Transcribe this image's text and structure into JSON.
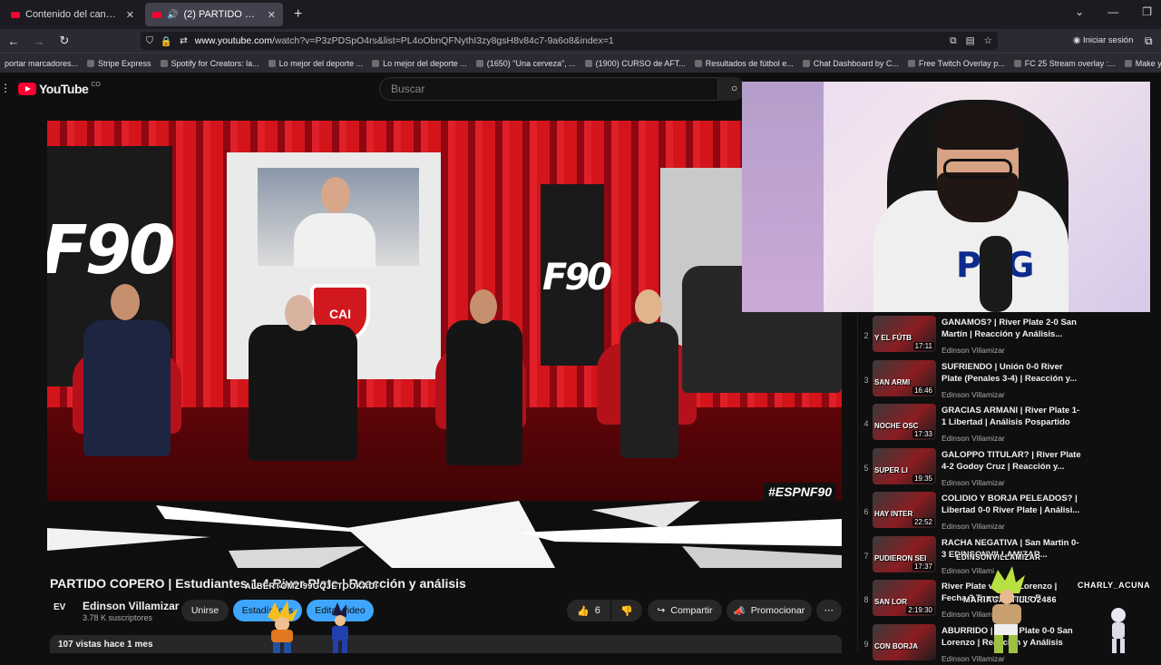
{
  "browser": {
    "tabs": [
      {
        "label": "Contenido del canal - YouTube",
        "active": false
      },
      {
        "label": "(2) PARTIDO COPERO | Estu",
        "active": true
      }
    ],
    "new_tab": "+",
    "window_controls": [
      "⌄",
      "—",
      "❐"
    ],
    "url": {
      "host": "www.youtube.com",
      "path": "/watch?v=P3zPDSpO4rs&list=PL4oObnQFNythI3zy8gsH8v84c7-9a6o8&index=1"
    },
    "sign_in": "Iniciar sesión",
    "bookmarks": [
      "portar marcadores...",
      "Stripe Express",
      "Spotify for Creators: la...",
      "Lo mejor del deporte ...",
      "Lo mejor del deporte ...",
      "(1650) \"Una cerveza\", ...",
      "(1900) CURSO de AFT...",
      "Resultados de fútbol e...",
      "Chat Dashboard by C...",
      "Free Twitch Overlay p...",
      "FC 25 Stream overlay :...",
      "Make your own poster..."
    ]
  },
  "youtube": {
    "logo": "YouTube",
    "logo_country": "CO",
    "search_placeholder": "Buscar"
  },
  "video": {
    "hashtag": "#ESPNF90",
    "f90": "F90",
    "crest": "CAI"
  },
  "title": "PARTIDO COPERO | Estudiantes 1-4 River Plate | Reacción y análisis",
  "overlay": {
    "user1": "ALBERTOMZ 99GQJETOOKADI",
    "user2": "MARIACASTILLO2486",
    "user3": "CHARLY_ACUNA",
    "user4": "EDINSONVILLAMIZAR"
  },
  "channel": {
    "avatar": "EV",
    "name": "Edinson Villamizar",
    "subs": "3.78 K suscriptores",
    "join": "Unirse",
    "stats": "Estadísticas",
    "edit": "Editar video",
    "likes": "6",
    "share": "Compartir",
    "promote": "Promocionar",
    "more": "⋯"
  },
  "description": {
    "views": "107 vistas  hace 1 mes"
  },
  "webcam": {
    "shirt_text": "PSG"
  },
  "playlist": [
    {
      "idx": "2",
      "thumb": "Y EL FÚTB",
      "dur": "17:11",
      "title": "GANAMOS? | River Plate 2-0 San Martín | Reacción y Análisis...",
      "channel": "Edinson Villamizar"
    },
    {
      "idx": "3",
      "thumb": "SAN ARMI",
      "dur": "16:46",
      "title": "SUFRIENDO | Unión 0-0 River Plate (Penales 3-4) | Reacción y...",
      "channel": "Edinson Villamizar"
    },
    {
      "idx": "4",
      "thumb": "NOCHE OSC",
      "dur": "17:33",
      "title": "GRACIAS ARMANI | River Plate 1-1 Libertad | Análisis Pospartido",
      "channel": "Edinson Villamizar"
    },
    {
      "idx": "5",
      "thumb": "SUPER LI",
      "dur": "19:35",
      "title": "GALOPPO TITULAR? | River Plate 4-2 Godoy Cruz | Reacción y...",
      "channel": "Edinson Villamizar"
    },
    {
      "idx": "6",
      "thumb": "HAY INTER",
      "dur": "22:52",
      "title": "COLIDIO Y BORJA PELEADOS? | Libertad 0-0 River Plate | Análisi...",
      "channel": "Edinson Villamizar"
    },
    {
      "idx": "7",
      "thumb": "PUDIERON SEI",
      "dur": "17:37",
      "title": "RACHA NEGATIVA | San Martin 0-3 EDINSONVILLAMIZAR...",
      "channel": "Edinson Villami"
    },
    {
      "idx": "8",
      "thumb": "SAN LOR",
      "dur": "2:19:30",
      "title": "River Plate vs San Lorenzo | Fecha 3 Torneo Grupo B ...",
      "channel": "Edinson Villamizar"
    },
    {
      "idx": "9",
      "thumb": "CON BORJA",
      "dur": "",
      "title": "ABURRIDO | River Plate 0-0 San Lorenzo | Reacción y Análisis",
      "channel": "Edinson Villamizar"
    }
  ],
  "colors": {
    "accent": "#3ea6ff",
    "brand": "#ff0033",
    "set_red": "#d3141b"
  }
}
